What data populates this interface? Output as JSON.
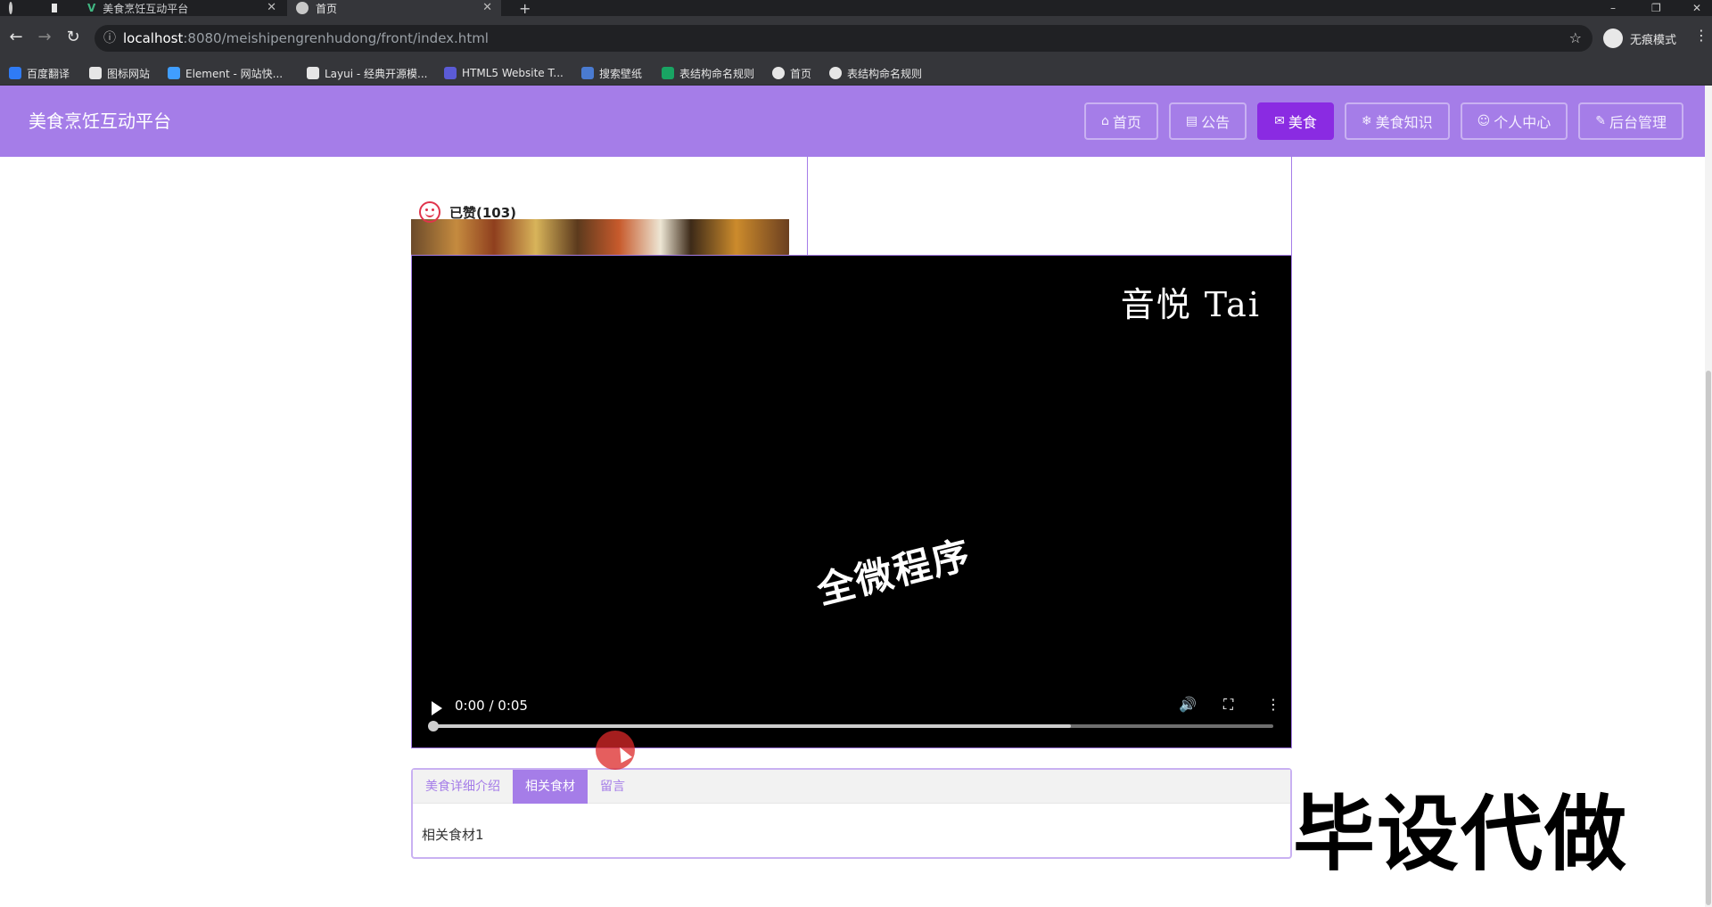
{
  "browser": {
    "tabs": [
      {
        "label": "美食烹饪互动平台",
        "active": false
      },
      {
        "label": "首页",
        "active": true
      }
    ],
    "new_tab": "+",
    "window_controls": {
      "minimize": "–",
      "restore": "❐",
      "close": "✕"
    },
    "url": {
      "host": "localhost",
      "path": ":8080/meishipengrenhudong/front/index.html"
    },
    "incognito_label": "无痕模式",
    "bookmarks": [
      {
        "label": "百度翻译",
        "color": "#2f7bf5"
      },
      {
        "label": "图标网站",
        "color": "#e6e6e6"
      },
      {
        "label": "Element - 网站快...",
        "color": "#409eff"
      },
      {
        "label": "Layui - 经典开源模...",
        "color": "#e6e6e6"
      },
      {
        "label": "HTML5 Website T...",
        "color": "#5b5bd6"
      },
      {
        "label": "搜索壁纸",
        "color": "#4a7bd1"
      },
      {
        "label": "表结构命名规则",
        "color": "#19a463"
      },
      {
        "label": "首页",
        "color": "#e6e6e6"
      },
      {
        "label": "表结构命名规则",
        "color": "#e6e6e6"
      }
    ]
  },
  "site": {
    "title": "美食烹饪互动平台",
    "nav": [
      {
        "icon": "⌂",
        "label": "首页",
        "active": false
      },
      {
        "icon": "▤",
        "label": "公告",
        "active": false
      },
      {
        "icon": "✉",
        "label": "美食",
        "active": true
      },
      {
        "icon": "❄",
        "label": "美食知识",
        "active": false
      },
      {
        "icon": "☺",
        "label": "个人中心",
        "active": false
      },
      {
        "icon": "✎",
        "label": "后台管理",
        "active": false
      }
    ]
  },
  "detail": {
    "like_text": "已赞(103)"
  },
  "video": {
    "watermark_top_right": "音悦 Tai",
    "center_text": "全微程序",
    "time": "0:00 / 0:05",
    "progress": 0,
    "buffered": 0.76
  },
  "tabs_panel": {
    "tabs": [
      {
        "label": "美食详细介绍",
        "active": false
      },
      {
        "label": "相关食材",
        "active": true
      },
      {
        "label": "留言",
        "active": false
      }
    ],
    "content": "相关食材1"
  },
  "overlay_text": "毕设代做",
  "colors": {
    "header": "#a57de8",
    "nav_active": "#8a2be2",
    "like": "#e0344b"
  }
}
